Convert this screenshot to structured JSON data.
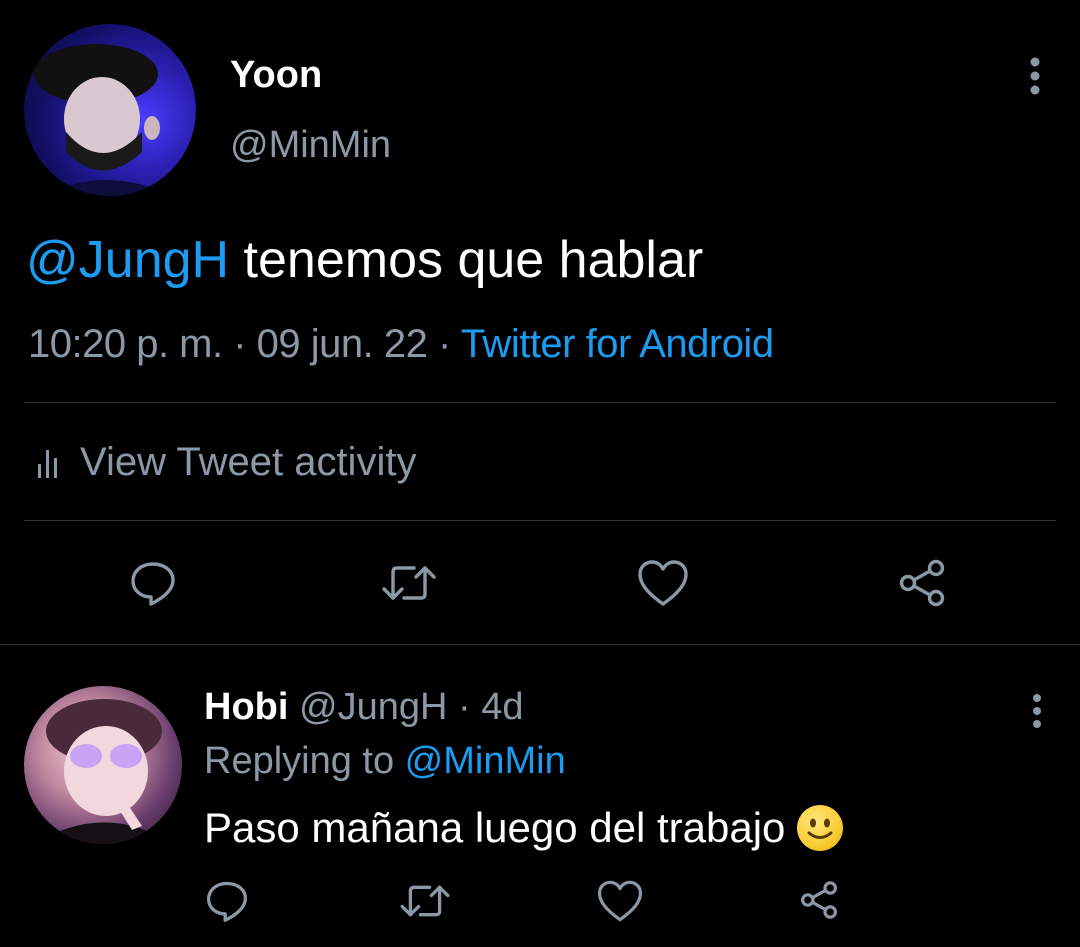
{
  "tweet": {
    "display_name": "Yoon",
    "handle": "@MinMin",
    "text_mention": "@JungH",
    "text_body": " tenemos que hablar",
    "time": "10:20 p. m.",
    "sep1": " · ",
    "date": "09 jun. 22",
    "sep2": " · ",
    "source": "Twitter for Android",
    "activity_label": "View Tweet activity"
  },
  "reply": {
    "display_name": "Hobi",
    "handle": " @JungH",
    "dot": " · ",
    "time": "4d",
    "replying_prefix": "Replying to ",
    "replying_mention": "@MinMin",
    "text": "Paso mañana luego del trabajo"
  },
  "icons": {
    "more": "more-vertical-icon",
    "reply": "comment-icon",
    "retweet": "retweet-icon",
    "like": "heart-icon",
    "share": "share-icon",
    "activity": "bar-chart-icon",
    "emoji": "slightly-smiling-face-emoji"
  },
  "colors": {
    "background": "#000000",
    "accent": "#1d9bf0",
    "secondary_text": "#8b98a5",
    "divider": "#2f3336"
  }
}
